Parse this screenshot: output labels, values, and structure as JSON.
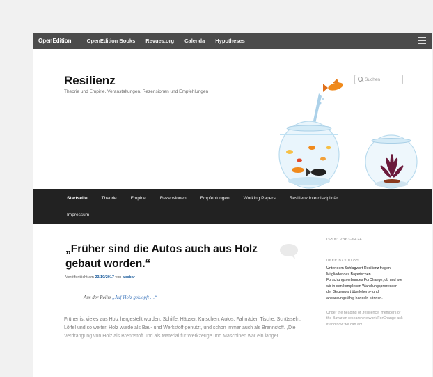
{
  "oe_bar": {
    "brand": "OpenEdition",
    "separator": ":",
    "links": [
      "OpenEdition Books",
      "Revues.org",
      "Calenda",
      "Hypotheses"
    ]
  },
  "site": {
    "title": "Resilienz",
    "description": "Theorie und Empirie, Veranstaltungen, Rezensionen und Empfehlungen",
    "search_placeholder": "Suchen"
  },
  "nav": {
    "row1": [
      "Startseite",
      "Theorie",
      "Empirie",
      "Rezensionen",
      "Empfehlungen",
      "Working Papers",
      "Resilienz interdisziplinär"
    ],
    "row2": [
      "Impressum"
    ]
  },
  "article": {
    "title": "„Früher sind die Autos auch aus Holz gebaut worden.“",
    "meta_prefix": "Veröffentlicht am",
    "date": "23/10/2017",
    "meta_by": "von",
    "author": "abcbar",
    "series_prefix": "Aus der Reihe",
    "series_link": "„Auf Holz geklopft …“",
    "body": "Früher ist vieles aus Holz hergestellt worden: Schiffe, Häuser, Kutschen, Autos, Fahrräder, Tische, Schüsseln, Löffel und so weiter. Holz wurde als Bau- und Werkstoff genutzt, und schon immer auch als Brennstoff. „Die Verdrängung von Holz als Brennstoff und als Material für Werkzeuge und Maschinen war ein langer"
  },
  "sidebar": {
    "issn": "ISSN: 2363-6424",
    "about_title": "ÜBER DAS BLOG",
    "about_de": "Unter dem Schlagwort Resilienz fragen Mitglieder des Bayerischen Forschungsverbundes ForChange, ob und wie wir in den komplexen Wandlungsprozessen der Gegenwart überlebens- und anpassungsfähig handeln können.",
    "about_en": "Under the heading of „resilience“ members of the Bavarian research network ForChange ask if and how we can act"
  },
  "colors": {
    "top_bar": "#4b4b4b",
    "nav_bar": "#222222",
    "link": "#1b5c9c",
    "fish": "#f08a1c"
  }
}
